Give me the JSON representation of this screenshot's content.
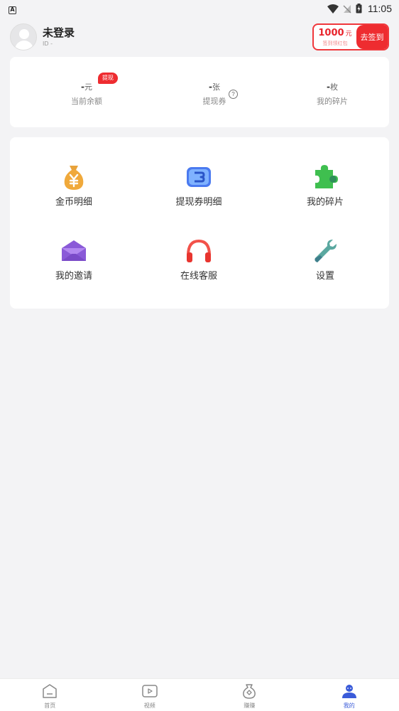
{
  "status_bar": {
    "left_icon": "A",
    "time": "11:05"
  },
  "header": {
    "user_name": "未登录",
    "user_id": "ID -",
    "signin_amount": "1000",
    "signin_unit": "元",
    "signin_sub": "签到领红包",
    "signin_button": "去签到"
  },
  "stats": {
    "withdraw_badge": "提现",
    "balance": {
      "value": "-",
      "unit": "元",
      "label": "当前余额"
    },
    "voucher": {
      "value": "-",
      "unit": "张",
      "label": "提现券"
    },
    "fragments": {
      "value": "-",
      "unit": "枚",
      "label": "我的碎片"
    },
    "help": "?"
  },
  "menu": {
    "items": [
      {
        "label": "金币明细",
        "icon": "money-bag-icon"
      },
      {
        "label": "提现券明细",
        "icon": "voucher-icon"
      },
      {
        "label": "我的碎片",
        "icon": "puzzle-icon"
      },
      {
        "label": "我的邀请",
        "icon": "envelope-icon"
      },
      {
        "label": "在线客服",
        "icon": "headphones-icon"
      },
      {
        "label": "设置",
        "icon": "wrench-icon"
      }
    ]
  },
  "bottom_nav": {
    "items": [
      {
        "label": "首页",
        "icon": "home-icon"
      },
      {
        "label": "视频",
        "icon": "video-icon"
      },
      {
        "label": "赚赚",
        "icon": "earn-icon"
      },
      {
        "label": "我的",
        "icon": "profile-icon"
      }
    ],
    "active": "我的"
  },
  "colors": {
    "accent_red": "#ee2c30",
    "nav_active": "#3a5bd9",
    "background": "#f3f3f5"
  }
}
